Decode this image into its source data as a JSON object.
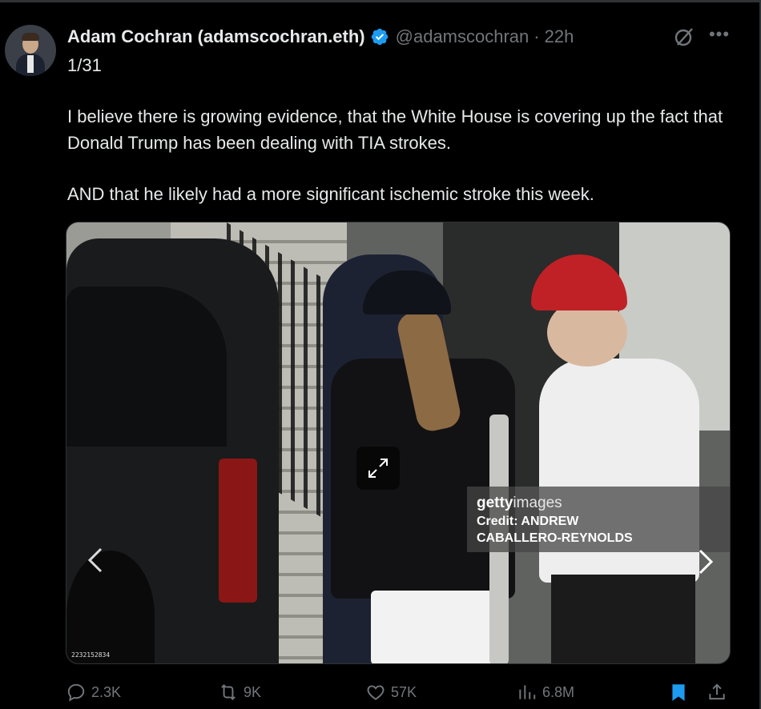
{
  "tweet": {
    "author_name": "Adam Cochran (adamscochran.eth)",
    "handle": "@adamscochran",
    "separator": "·",
    "time": "22h",
    "thread_position": "1/31",
    "paragraph_1": "I believe there is growing evidence, that the White House is covering up the fact that Donald Trump has been dealing with TIA strokes.",
    "paragraph_2": "AND that he likely had a more significant ischemic stroke this week.",
    "verified_color": "#1d9bf0"
  },
  "media": {
    "watermark_brand": "getty",
    "watermark_brand_suffix": "images",
    "credit_line_1": "Credit: ANDREW",
    "credit_line_2": "CABALLERO-REYNOLDS",
    "photo_id": "2232152834"
  },
  "actions": {
    "replies": "2.3K",
    "reposts": "9K",
    "likes": "57K",
    "views": "6.8M",
    "bookmark_color": "#1d9bf0"
  },
  "icons": [
    "grok-icon",
    "more-icon",
    "verified-icon",
    "expand-icon",
    "chevron-left-icon",
    "chevron-right-icon",
    "reply-icon",
    "retweet-icon",
    "like-icon",
    "views-icon",
    "bookmark-icon",
    "share-icon"
  ]
}
